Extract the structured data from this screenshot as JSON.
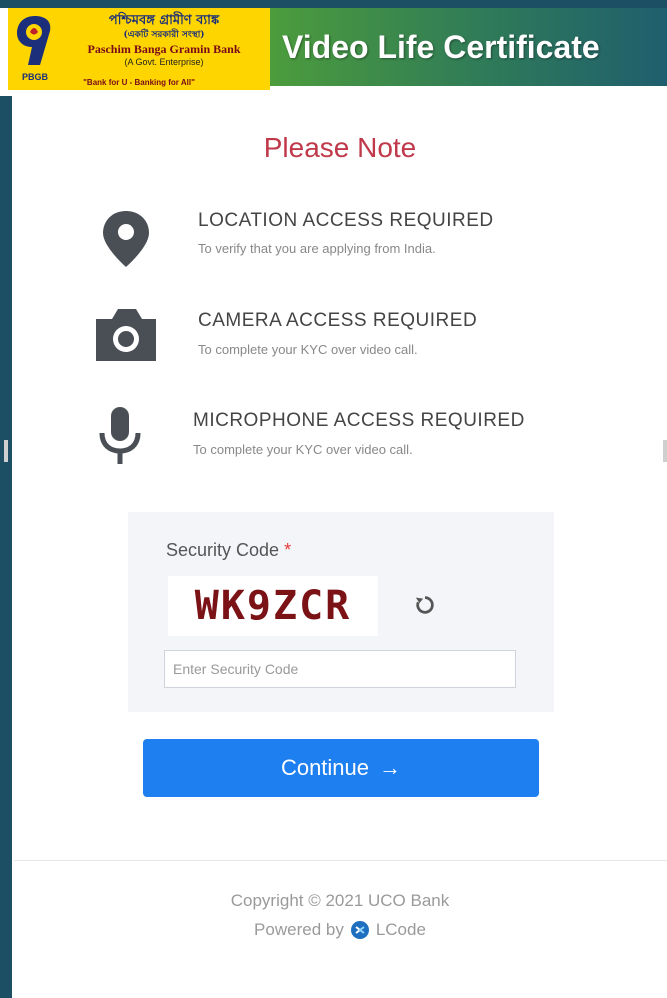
{
  "header": {
    "logo_abbr": "PBGB",
    "bank_name_bn": "পশ্চিমবঙ্গ গ্রামীণ ব্যাঙ্ক",
    "bank_sub_bn": "(একটি সরকারী সংস্থা)",
    "bank_name_en": "Paschim Banga Gramin Bank",
    "bank_sub_en": "(A Govt. Enterprise)",
    "tagline": "\"Bank for U - Banking for All\"",
    "banner_title": "Video Life Certificate"
  },
  "note": {
    "title": "Please Note",
    "permissions": [
      {
        "icon": "location-pin-icon",
        "title": "LOCATION ACCESS REQUIRED",
        "desc": "To verify that you are applying from India."
      },
      {
        "icon": "camera-icon",
        "title": "CAMERA ACCESS REQUIRED",
        "desc": "To complete your KYC over video call."
      },
      {
        "icon": "microphone-icon",
        "title": "MICROPHONE ACCESS REQUIRED",
        "desc": "To complete your KYC over video call."
      }
    ]
  },
  "security": {
    "label": "Security Code",
    "required_mark": "*",
    "captcha": "WK9ZCR",
    "input_placeholder": "Enter Security Code",
    "input_value": ""
  },
  "actions": {
    "continue_label": "Continue",
    "continue_arrow": "→"
  },
  "footer": {
    "copyright": "Copyright © 2021 UCO Bank",
    "powered_by": "Powered by",
    "brand": "LCode"
  },
  "colors": {
    "accent": "#1e7ff0",
    "note_title": "#c0394a",
    "captcha_text": "#7a1216",
    "logo_bg": "#ffd500"
  }
}
